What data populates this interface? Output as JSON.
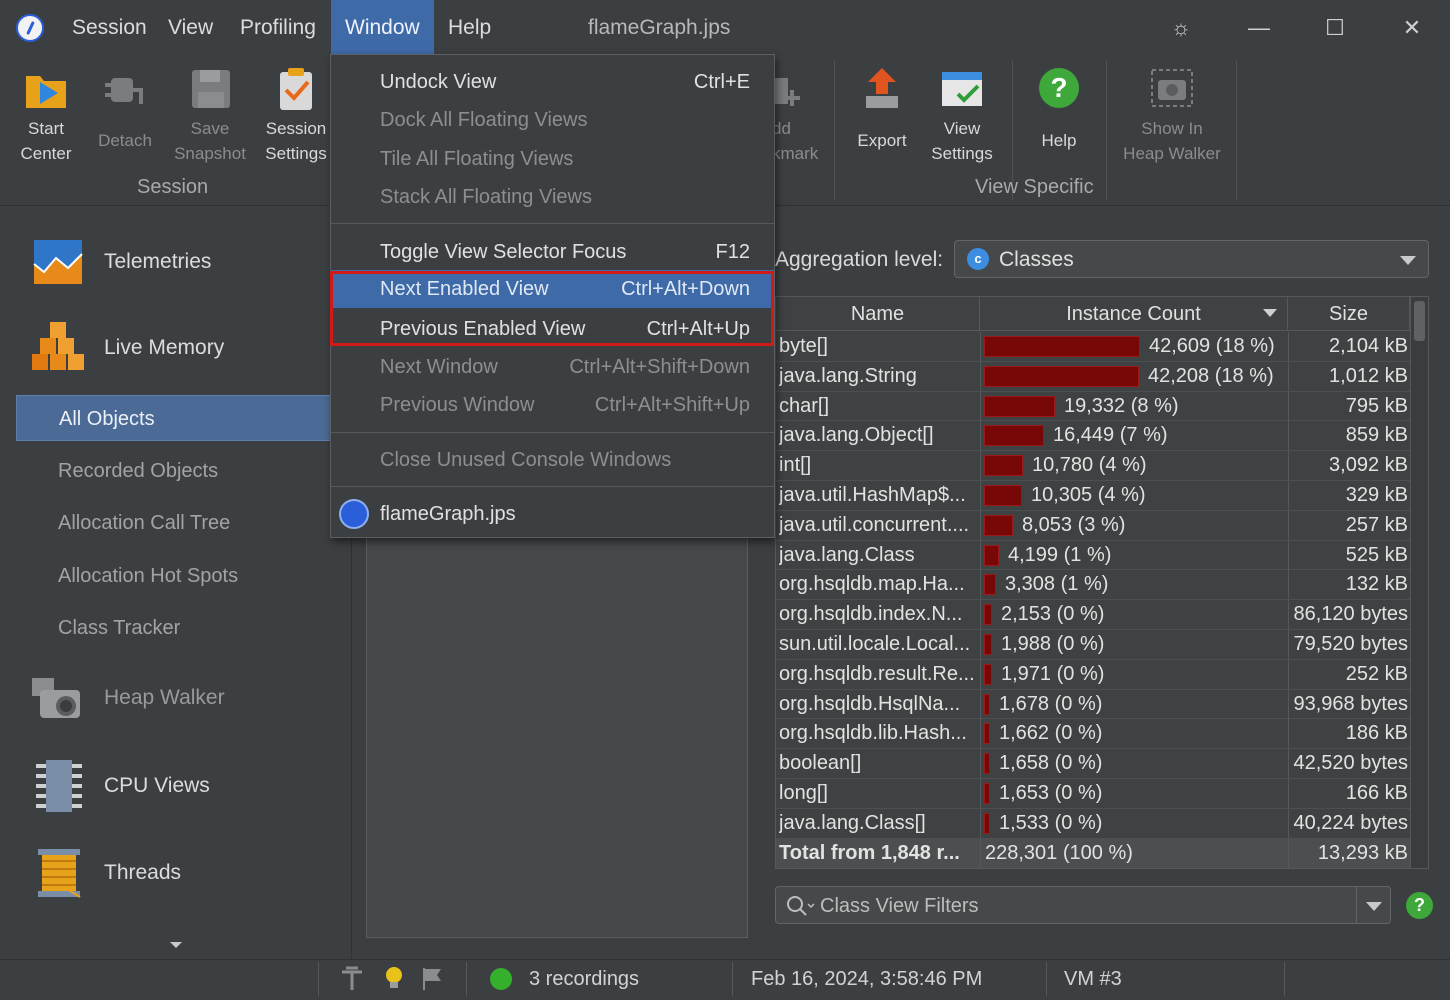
{
  "menubar": {
    "items": [
      "Session",
      "View",
      "Profiling",
      "Window",
      "Help"
    ],
    "title": "flameGraph.jps"
  },
  "toolbar": {
    "start_center": [
      "Start",
      "Center"
    ],
    "detach": "Detach",
    "save_snapshot": [
      "Save",
      "Snapshot"
    ],
    "session_settings": [
      "Session",
      "Settings"
    ],
    "session_group": "Session",
    "add_bookmark_partial": [
      "dd",
      "kmark"
    ],
    "export": "Export",
    "view_settings": [
      "View",
      "Settings"
    ],
    "help": "Help",
    "show_heap_walker": [
      "Show In",
      "Heap Walker"
    ],
    "view_specific_group": "View Specific"
  },
  "sidebar": {
    "telemetries": "Telemetries",
    "live_memory": "Live Memory",
    "sub_items": [
      "All Objects",
      "Recorded Objects",
      "Allocation Call Tree",
      "Allocation Hot Spots",
      "Class Tracker"
    ],
    "heap_walker": "Heap Walker",
    "cpu_views": "CPU Views",
    "threads": "Threads"
  },
  "window_menu": {
    "items": [
      {
        "label": "Undock View",
        "shortcut": "Ctrl+E",
        "state": "enabled"
      },
      {
        "label": "Dock All Floating Views",
        "shortcut": "",
        "state": "disabled"
      },
      {
        "label": "Tile All Floating Views",
        "shortcut": "",
        "state": "disabled"
      },
      {
        "label": "Stack All Floating Views",
        "shortcut": "",
        "state": "disabled"
      },
      {
        "label": "Toggle View Selector Focus",
        "shortcut": "F12",
        "state": "enabled"
      },
      {
        "label": "Next Enabled View",
        "shortcut": "Ctrl+Alt+Down",
        "state": "highlighted"
      },
      {
        "label": "Previous Enabled View",
        "shortcut": "Ctrl+Alt+Up",
        "state": "enabled"
      },
      {
        "label": "Next Window",
        "shortcut": "Ctrl+Alt+Shift+Down",
        "state": "disabled"
      },
      {
        "label": "Previous Window",
        "shortcut": "Ctrl+Alt+Shift+Up",
        "state": "disabled"
      },
      {
        "label": "Close Unused Console Windows",
        "shortcut": "",
        "state": "disabled"
      },
      {
        "label": "flameGraph.jps",
        "shortcut": "",
        "state": "enabled"
      }
    ]
  },
  "aggregation": {
    "label": "Aggregation level:",
    "value": "Classes",
    "icon_letter": "c"
  },
  "table": {
    "headers": [
      "Name",
      "Instance Count",
      "Size"
    ],
    "rows": [
      {
        "name": "byte[]",
        "count": "42,609 (18 %)",
        "share": 0.186,
        "size": "2,104 kB"
      },
      {
        "name": "java.lang.String",
        "count": "42,208 (18 %)",
        "share": 0.185,
        "size": "1,012 kB"
      },
      {
        "name": "char[]",
        "count": "19,332 (8 %)",
        "share": 0.085,
        "size": "795 kB"
      },
      {
        "name": "java.lang.Object[]",
        "count": "16,449 (7 %)",
        "share": 0.072,
        "size": "859 kB"
      },
      {
        "name": "int[]",
        "count": "10,780 (4 %)",
        "share": 0.047,
        "size": "3,092 kB"
      },
      {
        "name": "java.util.HashMap$...",
        "count": "10,305 (4 %)",
        "share": 0.045,
        "size": "329 kB"
      },
      {
        "name": "java.util.concurrent....",
        "count": "8,053 (3 %)",
        "share": 0.035,
        "size": "257 kB"
      },
      {
        "name": "java.lang.Class",
        "count": "4,199 (1 %)",
        "share": 0.018,
        "size": "525 kB"
      },
      {
        "name": "org.hsqldb.map.Ha...",
        "count": "3,308 (1 %)",
        "share": 0.014,
        "size": "132 kB"
      },
      {
        "name": "org.hsqldb.index.N...",
        "count": "2,153 (0 %)",
        "share": 0.009,
        "size": "86,120 bytes"
      },
      {
        "name": "sun.util.locale.Local...",
        "count": "1,988 (0 %)",
        "share": 0.009,
        "size": "79,520 bytes"
      },
      {
        "name": "org.hsqldb.result.Re...",
        "count": "1,971 (0 %)",
        "share": 0.009,
        "size": "252 kB"
      },
      {
        "name": "org.hsqldb.HsqlNa...",
        "count": "1,678 (0 %)",
        "share": 0.007,
        "size": "93,968 bytes"
      },
      {
        "name": "org.hsqldb.lib.Hash...",
        "count": "1,662 (0 %)",
        "share": 0.007,
        "size": "186 kB"
      },
      {
        "name": "boolean[]",
        "count": "1,658 (0 %)",
        "share": 0.007,
        "size": "42,520 bytes"
      },
      {
        "name": "long[]",
        "count": "1,653 (0 %)",
        "share": 0.007,
        "size": "166 kB"
      },
      {
        "name": "java.lang.Class[]",
        "count": "1,533 (0 %)",
        "share": 0.007,
        "size": "40,224 bytes"
      }
    ],
    "total": {
      "name": "Total from 1,848 r...",
      "count": "228,301 (100 %)",
      "size": "13,293 kB"
    }
  },
  "filter": {
    "placeholder": "Class View Filters"
  },
  "statusbar": {
    "recordings": "3 recordings",
    "datetime": "Feb 16, 2024, 3:58:46 PM",
    "vm": "VM #3"
  },
  "colors": {
    "accent": "#3f6aa8",
    "bar": "#780808",
    "highlight_outline": "#d01a1a",
    "recording_dot": "#34b02d"
  }
}
